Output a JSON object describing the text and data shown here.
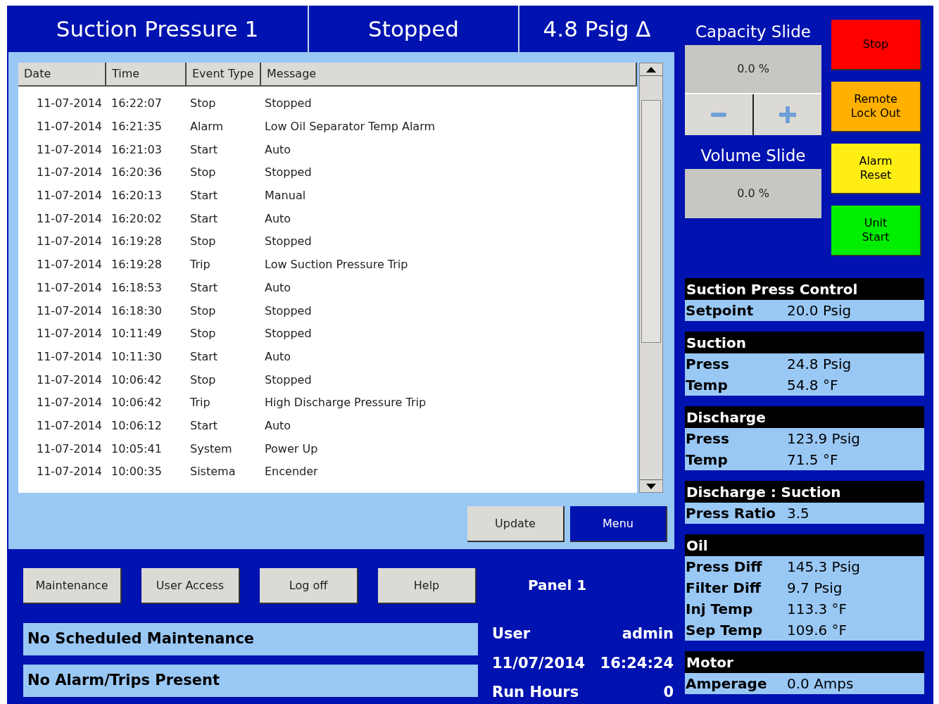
{
  "header": {
    "title": "Suction Pressure 1",
    "status": "Stopped",
    "delta": "4.8 Psig Δ"
  },
  "log": {
    "columns": [
      "Date",
      "Time",
      "Event Type",
      "Message"
    ],
    "rows": [
      {
        "date": "11-07-2014",
        "time": "16:22:07",
        "event_type": "Stop",
        "message": "Stopped"
      },
      {
        "date": "11-07-2014",
        "time": "16:21:35",
        "event_type": "Alarm",
        "message": "Low Oil Separator Temp Alarm"
      },
      {
        "date": "11-07-2014",
        "time": "16:21:03",
        "event_type": "Start",
        "message": "Auto"
      },
      {
        "date": "11-07-2014",
        "time": "16:20:36",
        "event_type": "Stop",
        "message": "Stopped"
      },
      {
        "date": "11-07-2014",
        "time": "16:20:13",
        "event_type": "Start",
        "message": "Manual"
      },
      {
        "date": "11-07-2014",
        "time": "16:20:02",
        "event_type": "Start",
        "message": "Auto"
      },
      {
        "date": "11-07-2014",
        "time": "16:19:28",
        "event_type": "Stop",
        "message": "Stopped"
      },
      {
        "date": "11-07-2014",
        "time": "16:19:28",
        "event_type": "Trip",
        "message": "Low Suction Pressure Trip"
      },
      {
        "date": "11-07-2014",
        "time": "16:18:53",
        "event_type": "Start",
        "message": "Auto"
      },
      {
        "date": "11-07-2014",
        "time": "16:18:30",
        "event_type": "Stop",
        "message": "Stopped"
      },
      {
        "date": "11-07-2014",
        "time": "10:11:49",
        "event_type": "Stop",
        "message": "Stopped"
      },
      {
        "date": "11-07-2014",
        "time": "10:11:30",
        "event_type": "Start",
        "message": "Auto"
      },
      {
        "date": "11-07-2014",
        "time": "10:06:42",
        "event_type": "Stop",
        "message": "Stopped"
      },
      {
        "date": "11-07-2014",
        "time": "10:06:42",
        "event_type": "Trip",
        "message": "High Discharge Pressure Trip"
      },
      {
        "date": "11-07-2014",
        "time": "10:06:12",
        "event_type": "Start",
        "message": "Auto"
      },
      {
        "date": "11-07-2014",
        "time": "10:05:41",
        "event_type": "System",
        "message": "Power Up"
      },
      {
        "date": "11-07-2014",
        "time": "10:00:35",
        "event_type": "Sistema",
        "message": "Encender"
      }
    ],
    "buttons": [
      "Update",
      "Menu"
    ]
  },
  "capacity_slide": {
    "title": "Capacity Slide",
    "value": "0.0 %"
  },
  "volume_slide": {
    "title": "Volume Slide",
    "value": "0.0 %"
  },
  "control_buttons": [
    {
      "label": "Stop",
      "color": "#ff0000"
    },
    {
      "label": "Remote Lock Out",
      "color": "#ffb000"
    },
    {
      "label": "Alarm Reset",
      "color": "#ffee14"
    },
    {
      "label": "Unit Start",
      "color": "#00ee00"
    }
  ],
  "sections": [
    {
      "title": "Suction Press Control",
      "rows": [
        {
          "label": "Setpoint",
          "value": "20.0 Psig"
        }
      ]
    },
    {
      "title": "Suction",
      "rows": [
        {
          "label": "Press",
          "value": "24.8 Psig"
        },
        {
          "label": "Temp",
          "value": "54.8 °F"
        }
      ]
    },
    {
      "title": "Discharge",
      "rows": [
        {
          "label": "Press",
          "value": "123.9 Psig"
        },
        {
          "label": "Temp",
          "value": "71.5 °F"
        }
      ]
    },
    {
      "title": "Discharge : Suction",
      "rows": [
        {
          "label": "Press Ratio",
          "value": "3.5"
        }
      ]
    },
    {
      "title": "Oil",
      "rows": [
        {
          "label": "Press Diff",
          "value": "145.3 Psig"
        },
        {
          "label": "Filter Diff",
          "value": "9.7 Psig"
        },
        {
          "label": "Inj Temp",
          "value": "113.3 °F"
        },
        {
          "label": "Sep Temp",
          "value": "109.6 °F"
        }
      ]
    },
    {
      "title": "Motor",
      "rows": [
        {
          "label": "Amperage",
          "value": "0.0 Amps"
        }
      ]
    }
  ],
  "nav_buttons": [
    "Maintenance",
    "User Access",
    "Log off",
    "Help"
  ],
  "status_messages": [
    "No Scheduled Maintenance",
    "No Alarm/Trips Present"
  ],
  "panel": {
    "name": "Panel 1",
    "user_label": "User",
    "user": "admin",
    "date": "11/07/2014",
    "time": "16:24:24",
    "run_hours_label": "Run Hours",
    "run_hours": "0"
  }
}
